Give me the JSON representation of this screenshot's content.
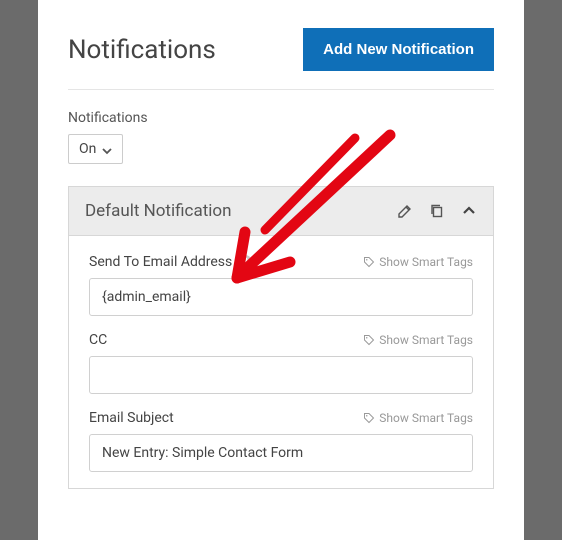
{
  "header": {
    "title": "Notifications",
    "add_button": "Add New Notification"
  },
  "toggle": {
    "label": "Notifications",
    "value": "On"
  },
  "card": {
    "title": "Default Notification",
    "fields": {
      "send_to": {
        "label": "Send To Email Address",
        "value": "{admin_email}",
        "smart_tags": "Show Smart Tags"
      },
      "cc": {
        "label": "CC",
        "value": "",
        "smart_tags": "Show Smart Tags"
      },
      "subject": {
        "label": "Email Subject",
        "value": "New Entry: Simple Contact Form",
        "smart_tags": "Show Smart Tags"
      }
    }
  }
}
